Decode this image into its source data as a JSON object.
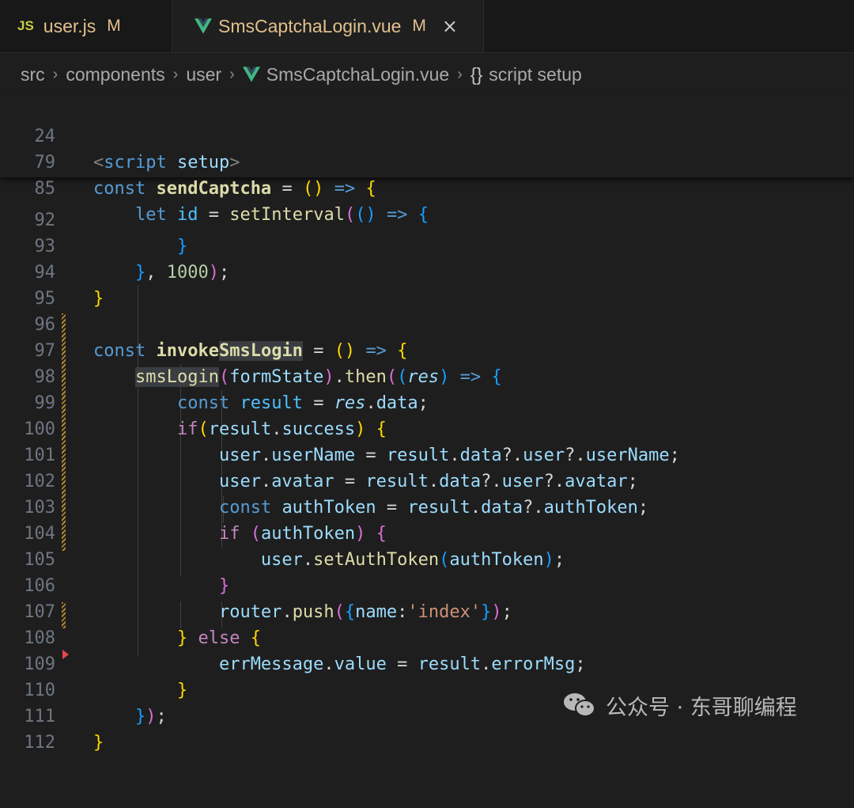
{
  "tabs": [
    {
      "icon": "JS",
      "label": "user.js",
      "status": "M"
    },
    {
      "icon": "vue-icon",
      "label": "SmsCaptchaLogin.vue",
      "status": "M",
      "close": "×"
    }
  ],
  "breadcrumbs": [
    "src",
    "components",
    "user",
    "SmsCaptchaLogin.vue",
    "{}",
    "script setup"
  ],
  "line_numbers": [
    "24",
    "79",
    "85",
    "92",
    "93",
    "94",
    "95",
    "96",
    "97",
    "98",
    "99",
    "100",
    "101",
    "102",
    "103",
    "104",
    "105",
    "106",
    "107",
    "108",
    "109",
    "110",
    "111",
    "112"
  ],
  "colors": {
    "background": "#1e1e1e",
    "modified": "#e2c08d",
    "vue": "#41b883",
    "keyword": "#569cd6",
    "function": "#dcdcaa",
    "variable": "#9cdcfe",
    "string": "#ce9178",
    "number": "#b5cea8"
  },
  "watermark": "公众号 · 东哥聊编程"
}
